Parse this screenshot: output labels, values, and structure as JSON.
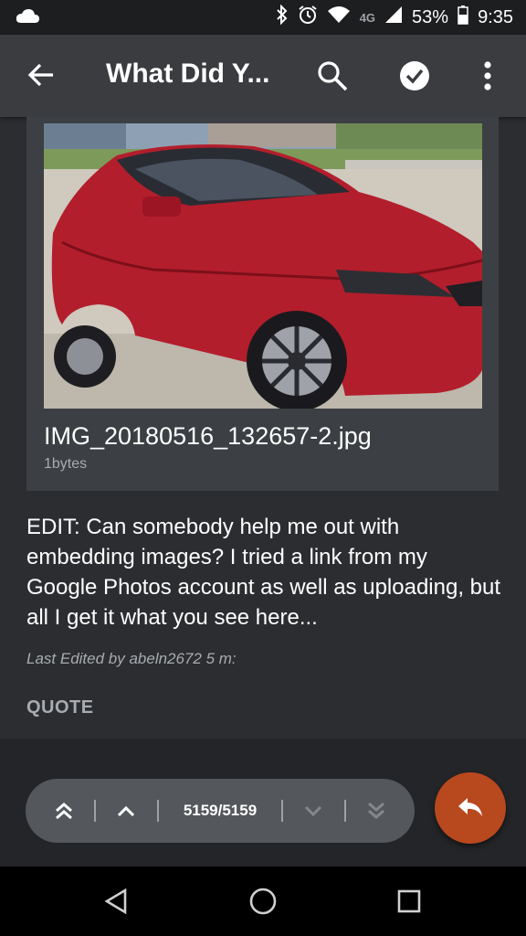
{
  "status_bar": {
    "network": "4G",
    "battery": "53%",
    "time": "9:35"
  },
  "app_bar": {
    "title": "What Did Y..."
  },
  "attachment": {
    "file_name": "IMG_20180516_132657-2.jpg",
    "file_size": "1bytes"
  },
  "post": {
    "body": "EDIT: Can somebody help me out with embedding images? I tried a link from my Google Photos account as well as uploading, but all I get it what you see here...",
    "edited": "Last Edited by abeln2672 5 m:",
    "quote_label": "QUOTE"
  },
  "pager": {
    "count": "5159/5159"
  },
  "colors": {
    "background": "#2b2d30",
    "appbar": "#3a3c3f",
    "fab": "#b8481e",
    "pager": "#54575b"
  }
}
